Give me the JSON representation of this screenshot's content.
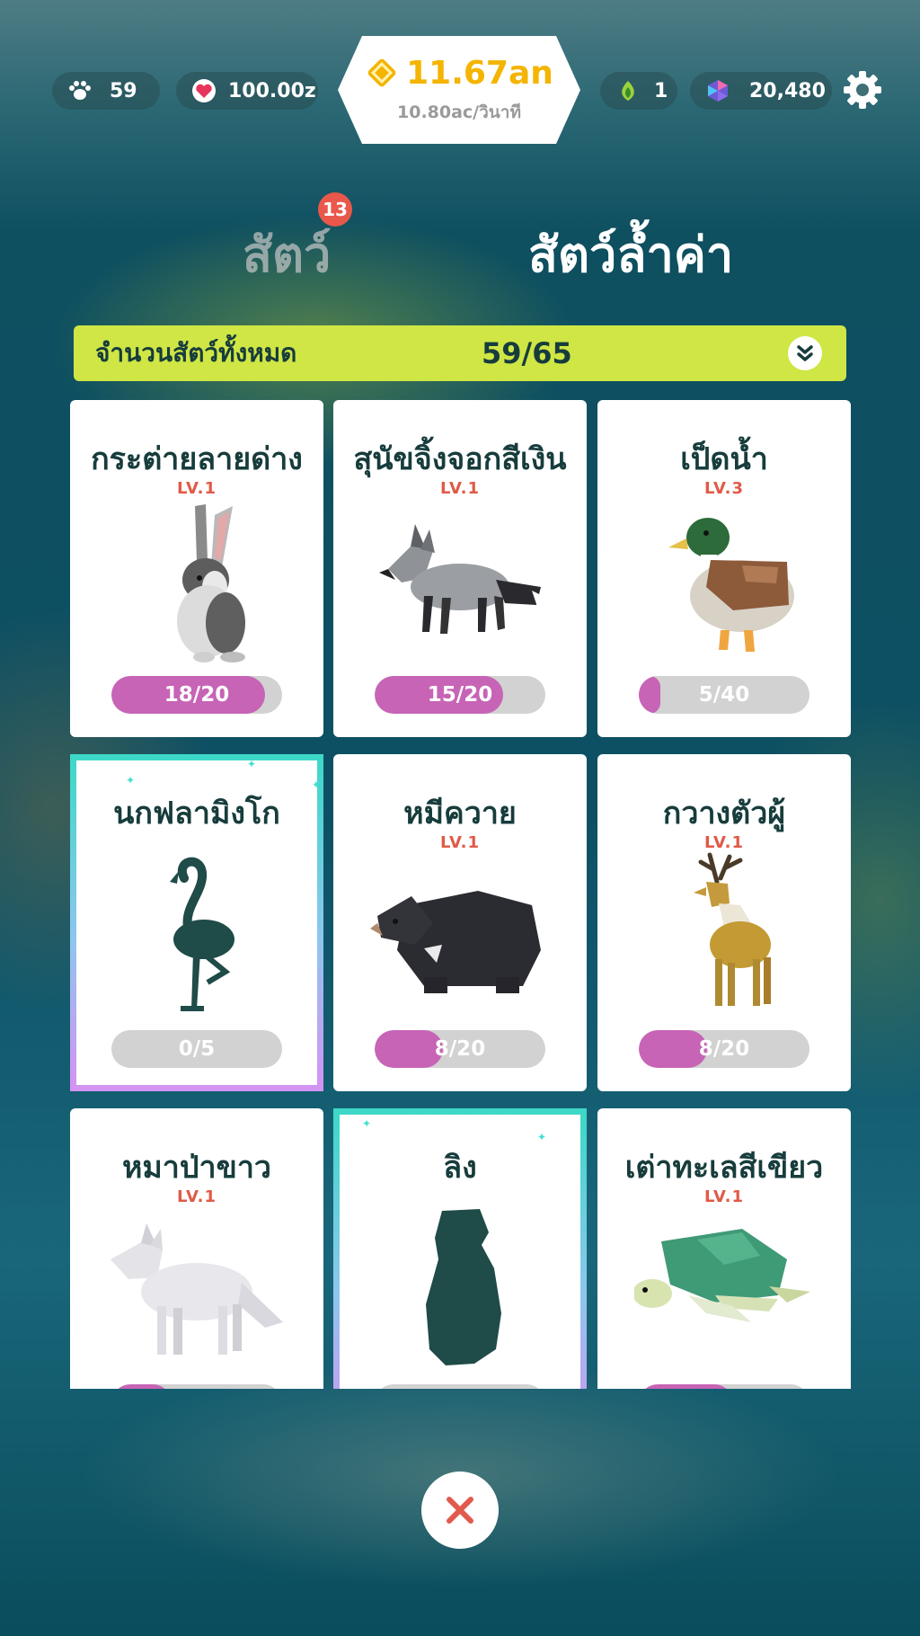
{
  "hud": {
    "paw_count": "59",
    "hearts": "100.00z",
    "money": "11.67an",
    "money_rate": "10.80ac/วินาที",
    "leaf": "1",
    "gems": "20,480"
  },
  "tabs": {
    "animals_label": "สัตว์",
    "animals_badge": "13",
    "rare_label": "สัตว์ล้ำค่า"
  },
  "summary": {
    "label": "จำนวนสัตว์ทั้งหมด",
    "count": "59/65"
  },
  "cards": [
    {
      "name": "กระต่ายลายด่าง",
      "level": "LV.1",
      "progress_text": "18/20",
      "progress": 0.9,
      "locked": false,
      "icon": "rabbit-icon"
    },
    {
      "name": "สุนัขจิ้งจอกสีเงิน",
      "level": "LV.1",
      "progress_text": "15/20",
      "progress": 0.75,
      "locked": false,
      "icon": "fox-icon"
    },
    {
      "name": "เป็ดน้ำ",
      "level": "LV.3",
      "progress_text": "5/40",
      "progress": 0.125,
      "locked": false,
      "icon": "duck-icon"
    },
    {
      "name": "นกฟลามิงโก",
      "level": "",
      "progress_text": "0/5",
      "progress": 0,
      "locked": true,
      "icon": "flamingo-icon"
    },
    {
      "name": "หมีควาย",
      "level": "LV.1",
      "progress_text": "8/20",
      "progress": 0.4,
      "locked": false,
      "icon": "bear-icon"
    },
    {
      "name": "กวางตัวผู้",
      "level": "LV.1",
      "progress_text": "8/20",
      "progress": 0.4,
      "locked": false,
      "icon": "deer-icon"
    },
    {
      "name": "หมาป่าขาว",
      "level": "LV.1",
      "progress_text": "",
      "progress": 0.35,
      "locked": false,
      "icon": "wolf-icon"
    },
    {
      "name": "ลิง",
      "level": "",
      "progress_text": "",
      "progress": 0,
      "locked": true,
      "icon": "monkey-icon"
    },
    {
      "name": "เต่าทะเลสีเขียว",
      "level": "LV.1",
      "progress_text": "",
      "progress": 0.55,
      "locked": false,
      "icon": "turtle-icon"
    }
  ],
  "colors": {
    "accent_gold": "#f4b400",
    "progress_fill": "#c764b6",
    "level_red": "#e05a47",
    "summary_bar": "#cfe645"
  }
}
